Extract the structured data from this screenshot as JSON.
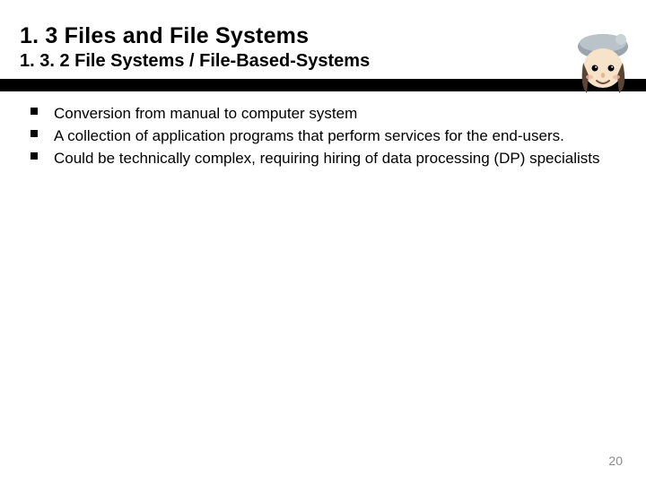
{
  "header": {
    "title": "1. 3 Files and File Systems",
    "subtitle": "1. 3. 2 File Systems / File-Based-Systems"
  },
  "bullets": [
    "Conversion from manual to computer system",
    "A collection of application programs that perform services for the end-users.",
    "Could be technically complex, requiring hiring of data processing (DP) specialists"
  ],
  "page_number": "20"
}
